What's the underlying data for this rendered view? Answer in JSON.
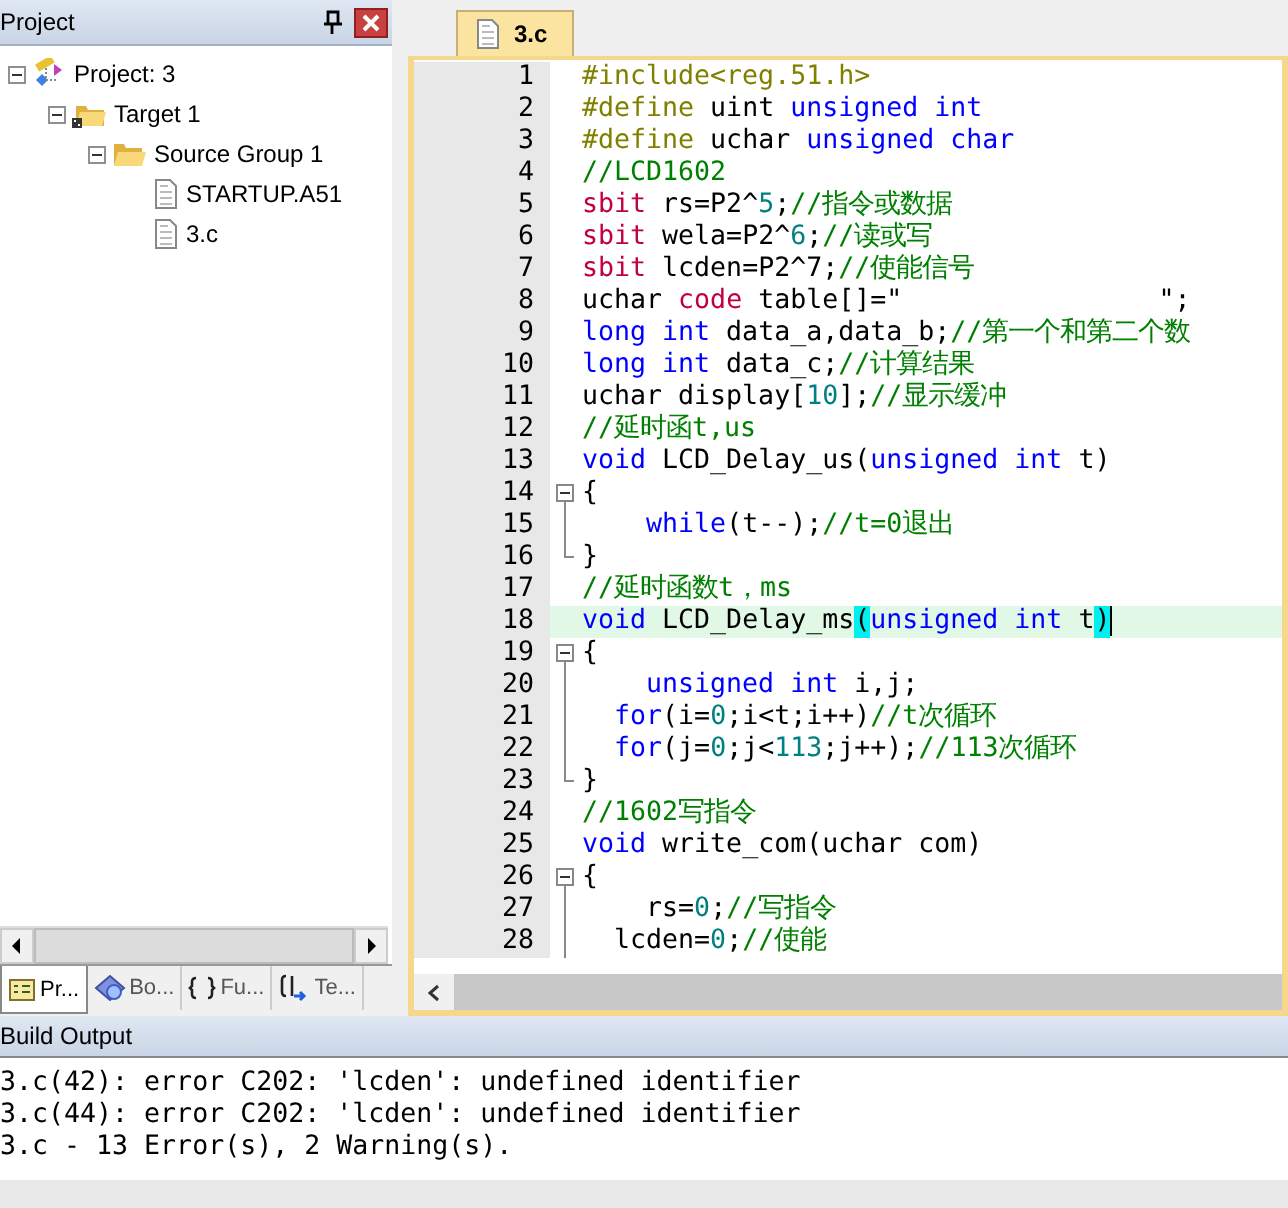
{
  "project_panel": {
    "title": "Project",
    "tree": [
      {
        "label": "Project: 3",
        "kind": "project",
        "expanded": true,
        "children": [
          {
            "label": "Target 1",
            "kind": "target",
            "expanded": true,
            "children": [
              {
                "label": "Source Group 1",
                "kind": "group",
                "expanded": true,
                "children": [
                  {
                    "label": "STARTUP.A51",
                    "kind": "file"
                  },
                  {
                    "label": "3.c",
                    "kind": "file"
                  }
                ]
              }
            ]
          }
        ]
      }
    ],
    "tabs": [
      {
        "label": "Pr...",
        "kind": "project",
        "selected": true
      },
      {
        "label": "Bo...",
        "kind": "books",
        "selected": false
      },
      {
        "label": "Fu...",
        "kind": "functions",
        "selected": false
      },
      {
        "label": "Te...",
        "kind": "templates",
        "selected": false
      }
    ]
  },
  "editor": {
    "tabs": [
      {
        "label": "3.c",
        "selected": true
      }
    ],
    "lines": [
      {
        "number": "1",
        "segments": [
          {
            "kind": "pp",
            "text": "#include<reg.51.h>"
          }
        ]
      },
      {
        "number": "2",
        "segments": [
          {
            "kind": "pp",
            "text": "#define"
          },
          {
            "kind": "txt",
            "text": " uint "
          },
          {
            "kind": "kw",
            "text": "unsigned int"
          }
        ]
      },
      {
        "number": "3",
        "segments": [
          {
            "kind": "pp",
            "text": "#define"
          },
          {
            "kind": "txt",
            "text": " uchar "
          },
          {
            "kind": "kw",
            "text": "unsigned char"
          }
        ]
      },
      {
        "number": "4",
        "segments": [
          {
            "kind": "cm",
            "text": "//LCD1602"
          }
        ]
      },
      {
        "number": "5",
        "segments": [
          {
            "kind": "kw2",
            "text": "sbit"
          },
          {
            "kind": "txt",
            "text": " rs=P2^"
          },
          {
            "kind": "num",
            "text": "5"
          },
          {
            "kind": "txt",
            "text": ";"
          },
          {
            "kind": "cm",
            "text": "//指令或数据"
          }
        ]
      },
      {
        "number": "6",
        "segments": [
          {
            "kind": "kw2",
            "text": "sbit"
          },
          {
            "kind": "txt",
            "text": " wela=P2^"
          },
          {
            "kind": "num",
            "text": "6"
          },
          {
            "kind": "txt",
            "text": ";"
          },
          {
            "kind": "cm",
            "text": "//读或写"
          }
        ]
      },
      {
        "number": "7",
        "segments": [
          {
            "kind": "kw2",
            "text": "sbit"
          },
          {
            "kind": "txt",
            "text": " lcden=P2^7;"
          },
          {
            "kind": "cm",
            "text": "//使能信号"
          }
        ]
      },
      {
        "number": "8",
        "segments": [
          {
            "kind": "txt",
            "text": "uchar "
          },
          {
            "kind": "kw2",
            "text": "code"
          },
          {
            "kind": "txt",
            "text": " table[]=\"                \";"
          }
        ]
      },
      {
        "number": "9",
        "segments": [
          {
            "kind": "kw",
            "text": "long int"
          },
          {
            "kind": "txt",
            "text": " data_a,data_b;"
          },
          {
            "kind": "cm",
            "text": "//第一个和第二个数"
          }
        ]
      },
      {
        "number": "10",
        "segments": [
          {
            "kind": "kw",
            "text": "long int"
          },
          {
            "kind": "txt",
            "text": " data_c;"
          },
          {
            "kind": "cm",
            "text": "//计算结果"
          }
        ]
      },
      {
        "number": "11",
        "segments": [
          {
            "kind": "txt",
            "text": "uchar display["
          },
          {
            "kind": "num",
            "text": "10"
          },
          {
            "kind": "txt",
            "text": "];"
          },
          {
            "kind": "cm",
            "text": "//显示缓冲"
          }
        ]
      },
      {
        "number": "12",
        "segments": [
          {
            "kind": "cm",
            "text": "//延时函t,us"
          }
        ]
      },
      {
        "number": "13",
        "segments": [
          {
            "kind": "kw",
            "text": "void"
          },
          {
            "kind": "txt",
            "text": " LCD_Delay_us("
          },
          {
            "kind": "kw",
            "text": "unsigned int"
          },
          {
            "kind": "txt",
            "text": " t)"
          }
        ]
      },
      {
        "number": "14",
        "fold_start": true,
        "segments": [
          {
            "kind": "txt",
            "text": "{"
          }
        ]
      },
      {
        "number": "15",
        "in_fold": true,
        "segments": [
          {
            "kind": "kw",
            "text": "    while"
          },
          {
            "kind": "txt",
            "text": "(t--);"
          },
          {
            "kind": "cm",
            "text": "//t=0退出"
          }
        ]
      },
      {
        "number": "16",
        "fold_end": true,
        "segments": [
          {
            "kind": "txt",
            "text": "}"
          }
        ]
      },
      {
        "number": "17",
        "segments": [
          {
            "kind": "cm",
            "text": "//延时函数t，ms"
          }
        ]
      },
      {
        "number": "18",
        "current": true,
        "segments": [
          {
            "kind": "kw",
            "text": "void"
          },
          {
            "kind": "txt",
            "text": " LCD_Delay_ms"
          },
          {
            "kind": "brace",
            "text": "("
          },
          {
            "kind": "kw",
            "text": "unsigned int"
          },
          {
            "kind": "txt",
            "text": " t"
          },
          {
            "kind": "brace",
            "text": ")"
          }
        ]
      },
      {
        "number": "19",
        "fold_start": true,
        "segments": [
          {
            "kind": "txt",
            "text": "{"
          }
        ]
      },
      {
        "number": "20",
        "in_fold": true,
        "segments": [
          {
            "kind": "kw",
            "text": "    unsigned int"
          },
          {
            "kind": "txt",
            "text": " i,j;"
          }
        ]
      },
      {
        "number": "21",
        "in_fold": true,
        "segments": [
          {
            "kind": "kw",
            "text": "  for"
          },
          {
            "kind": "txt",
            "text": "(i="
          },
          {
            "kind": "num",
            "text": "0"
          },
          {
            "kind": "txt",
            "text": ";i<t;i++)"
          },
          {
            "kind": "cm",
            "text": "//t次循环"
          }
        ]
      },
      {
        "number": "22",
        "in_fold": true,
        "segments": [
          {
            "kind": "kw",
            "text": "  for"
          },
          {
            "kind": "txt",
            "text": "(j="
          },
          {
            "kind": "num",
            "text": "0"
          },
          {
            "kind": "txt",
            "text": ";j<"
          },
          {
            "kind": "num",
            "text": "113"
          },
          {
            "kind": "txt",
            "text": ";j++);"
          },
          {
            "kind": "cm",
            "text": "//113次循环"
          }
        ]
      },
      {
        "number": "23",
        "fold_end": true,
        "segments": [
          {
            "kind": "txt",
            "text": "}"
          }
        ]
      },
      {
        "number": "24",
        "segments": [
          {
            "kind": "cm",
            "text": "//1602写指令"
          }
        ]
      },
      {
        "number": "25",
        "segments": [
          {
            "kind": "kw",
            "text": "void"
          },
          {
            "kind": "txt",
            "text": " write_com(uchar com)"
          }
        ]
      },
      {
        "number": "26",
        "fold_start": true,
        "segments": [
          {
            "kind": "txt",
            "text": "{"
          }
        ]
      },
      {
        "number": "27",
        "in_fold": true,
        "segments": [
          {
            "kind": "txt",
            "text": "    rs="
          },
          {
            "kind": "num",
            "text": "0"
          },
          {
            "kind": "txt",
            "text": ";"
          },
          {
            "kind": "cm",
            "text": "//写指令"
          }
        ]
      },
      {
        "number": "28",
        "in_fold": true,
        "segments": [
          {
            "kind": "txt",
            "text": "  lcden="
          },
          {
            "kind": "num",
            "text": "0"
          },
          {
            "kind": "txt",
            "text": ";"
          },
          {
            "kind": "cm",
            "text": "//使能"
          }
        ]
      }
    ]
  },
  "build_output": {
    "title": "Build Output",
    "lines": [
      "3.c(42): error C202: 'lcden': undefined identifier",
      "3.c(44): error C202: 'lcden': undefined identifier",
      "3.c - 13 Error(s), 2 Warning(s)."
    ]
  }
}
